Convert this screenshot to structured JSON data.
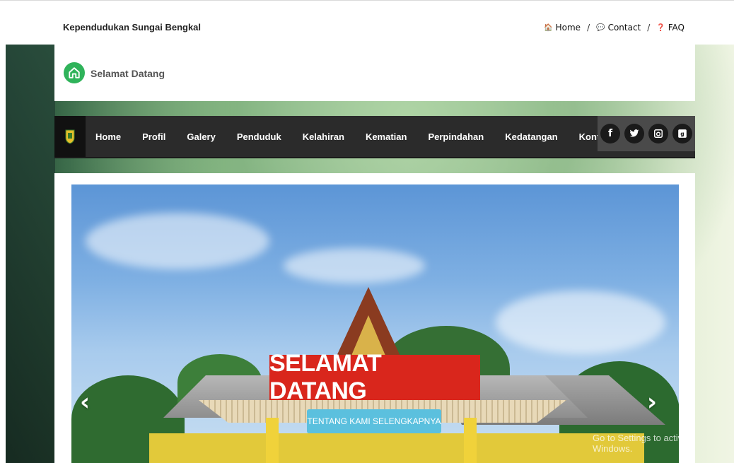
{
  "topbar": {
    "site_name": "Kependudukan Sungai Bengkal",
    "links": [
      {
        "icon": "home-icon",
        "label": "Home"
      },
      {
        "icon": "comments-icon",
        "label": "Contact"
      },
      {
        "icon": "question-circle-icon",
        "label": "FAQ"
      }
    ],
    "separator": "/"
  },
  "welcome": {
    "title": "Selamat Datang",
    "icon": "home-icon",
    "icon_color": "#2fb35a"
  },
  "nav": {
    "logo_icon": "regency-crest-icon",
    "items": [
      "Home",
      "Profil",
      "Galery",
      "Penduduk",
      "Kelahiran",
      "Kematian",
      "Perpindahan",
      "Kedatangan",
      "Kontak"
    ],
    "socials": [
      {
        "icon": "facebook-icon",
        "glyph": "f"
      },
      {
        "icon": "twitter-icon",
        "glyph": "🐦"
      },
      {
        "icon": "instagram-icon",
        "glyph": "◙"
      },
      {
        "icon": "google-plus-icon",
        "glyph": "8"
      }
    ]
  },
  "slider": {
    "title": "SELAMAT DATANG",
    "button_label": "TENTANG KAMI SELENGKAPNYA",
    "title_bg": "#d9261c",
    "button_bg": "#5bc0de",
    "prev_glyph": "‹",
    "next_glyph": "›"
  },
  "watermark": {
    "text": "Go to Settings to activate Windows."
  }
}
